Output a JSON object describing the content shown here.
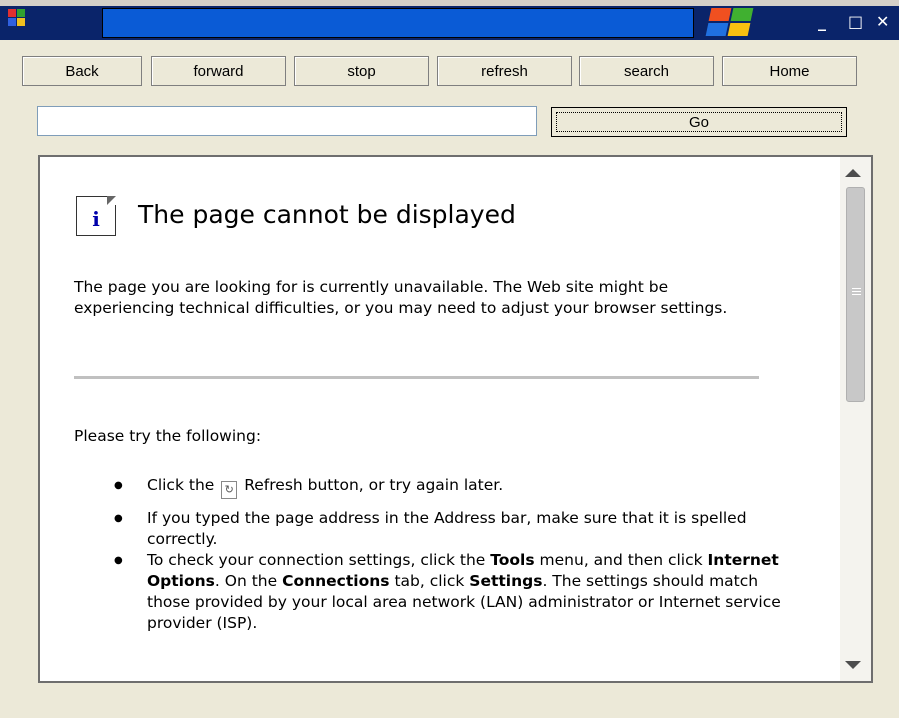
{
  "window": {
    "minimize_label": "_",
    "maximize_label": "□",
    "close_label": "✕"
  },
  "toolbar": {
    "back_label": "Back",
    "forward_label": "forward",
    "stop_label": "stop",
    "refresh_label": "refresh",
    "search_label": "search",
    "home_label": "Home"
  },
  "address": {
    "value": "",
    "go_label": "Go"
  },
  "page": {
    "heading": "The page cannot be displayed",
    "description": "The page you are looking for is currently unavailable. The Web site might be experiencing technical difficulties, or you may need to adjust your browser settings.",
    "try_label": "Please try the following:",
    "tip1_prefix": "Click the",
    "tip1_suffix": "Refresh button, or try again later.",
    "tip2": "If you typed the page address in the Address bar, make sure that it is spelled correctly.",
    "tip3_part1": "To check your connection settings, click the ",
    "tip3_bold1": "Tools",
    "tip3_part2": " menu, and then click ",
    "tip3_bold2": "Internet Options",
    "tip3_part3": ". On the ",
    "tip3_bold3": "Connections",
    "tip3_part4": " tab, click ",
    "tip3_bold4": "Settings",
    "tip3_part5": ". The settings should match those provided by your local area network (LAN) administrator or Internet service provider (ISP)."
  },
  "icons": {
    "app": "app-icon",
    "windows_logo": "windows-logo",
    "info": "info-icon",
    "refresh": "refresh-icon"
  },
  "colors": {
    "title_bar": "#0A246A",
    "title_field": "#0A5BD6",
    "info_icon": "#0000AA"
  }
}
